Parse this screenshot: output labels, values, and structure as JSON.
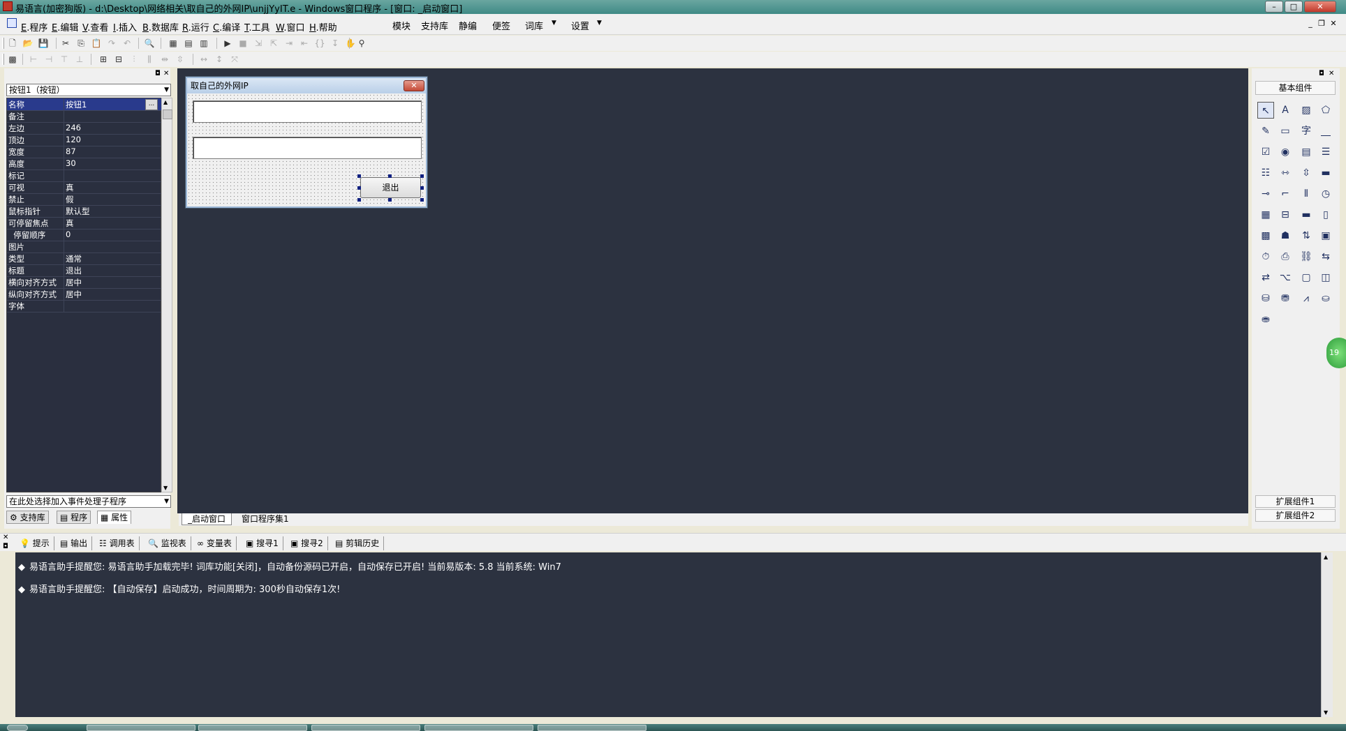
{
  "window": {
    "title": "易语言(加密狗版) - d:\\Desktop\\网络相关\\取自己的外网IP\\unjjYyIT.e - Windows窗口程序 - [窗口: _启动窗口]",
    "min": "–",
    "max": "□",
    "close": "✕"
  },
  "menu": {
    "items": [
      {
        "key": "E",
        "label": ".程序"
      },
      {
        "key": "E",
        "label": ".编辑"
      },
      {
        "key": "V",
        "label": ".查看"
      },
      {
        "key": "I",
        "label": ".插入"
      },
      {
        "key": "B",
        "label": ".数据库"
      },
      {
        "key": "R",
        "label": ".运行"
      },
      {
        "key": "C",
        "label": ".编译"
      },
      {
        "key": "T",
        "label": ".工具"
      },
      {
        "key": "W",
        "label": ".窗口"
      },
      {
        "key": "H",
        "label": ".帮助"
      }
    ],
    "extra": [
      "模块",
      "支持库",
      "静编",
      "便签",
      "词库",
      "设置"
    ],
    "dropdown_arrow": "▼"
  },
  "left_panel": {
    "object_select": "按钮1（按钮）",
    "properties": [
      {
        "name": "名称",
        "value": "按钮1"
      },
      {
        "name": "备注",
        "value": ""
      },
      {
        "name": "左边",
        "value": "246"
      },
      {
        "name": "顶边",
        "value": "120"
      },
      {
        "name": "宽度",
        "value": "87"
      },
      {
        "name": "高度",
        "value": "30"
      },
      {
        "name": "标记",
        "value": ""
      },
      {
        "name": "可视",
        "value": "真"
      },
      {
        "name": "禁止",
        "value": "假"
      },
      {
        "name": "鼠标指针",
        "value": "默认型"
      },
      {
        "name": "可停留焦点",
        "value": "真"
      },
      {
        "name": "  停留顺序",
        "value": "0"
      },
      {
        "name": "图片",
        "value": ""
      },
      {
        "name": "类型",
        "value": "通常"
      },
      {
        "name": "标题",
        "value": "退出"
      },
      {
        "name": "横向对齐方式",
        "value": "居中"
      },
      {
        "name": "纵向对齐方式",
        "value": "居中"
      },
      {
        "name": "字体",
        "value": ""
      }
    ],
    "ellipsis": "...",
    "event_select": "在此处选择加入事件处理子程序",
    "tabs": [
      "支持库",
      "程序",
      "属性"
    ]
  },
  "editor": {
    "form_title": "取自己的外网IP",
    "form_close": "✕",
    "exit_button": "退出",
    "tabs": [
      "_启动窗口",
      "窗口程序集1"
    ]
  },
  "right_panel": {
    "basic_label": "基本组件",
    "ext1": "扩展组件1",
    "ext2": "扩展组件2"
  },
  "output": {
    "tabs": [
      "提示",
      "输出",
      "调用表",
      "监视表",
      "变量表",
      "搜寻1",
      "搜寻2",
      "剪辑历史"
    ],
    "lines": [
      "易语言助手提醒您:  易语言助手加载完毕!  词库功能[关闭]，自动备份源码已开启，自动保存已开启!  当前易版本: 5.8  当前系统: Win7",
      "易语言助手提醒您: 【自动保存】启动成功，时间周期为: 300秒自动保存1次!"
    ]
  },
  "float_badge": "19"
}
